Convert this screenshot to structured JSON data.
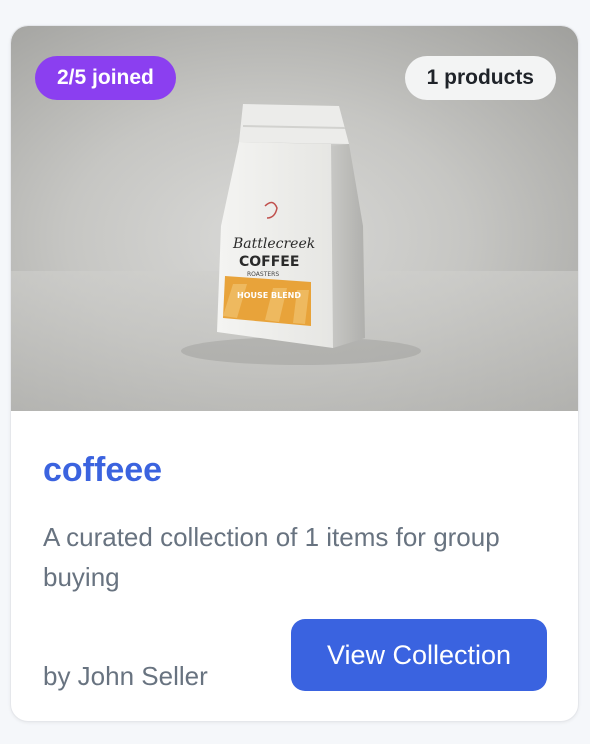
{
  "card": {
    "badges": {
      "joined": "2/5 joined",
      "products": "1 products"
    },
    "image": {
      "icon": "coffee-bag-photo",
      "bag_text": {
        "brand": "Battlecreek",
        "name": "COFFEE",
        "sub": "ROASTERS",
        "label": "HOUSE BLEND"
      }
    },
    "title": "coffeee",
    "description": "A curated collection of 1 items for group buying",
    "seller": "by John Seller",
    "cta_label": "View Collection"
  },
  "colors": {
    "accent": "#3a63e0",
    "title": "#3b63df",
    "joined_badge": "#8b3ff0",
    "muted_text": "#687380"
  }
}
